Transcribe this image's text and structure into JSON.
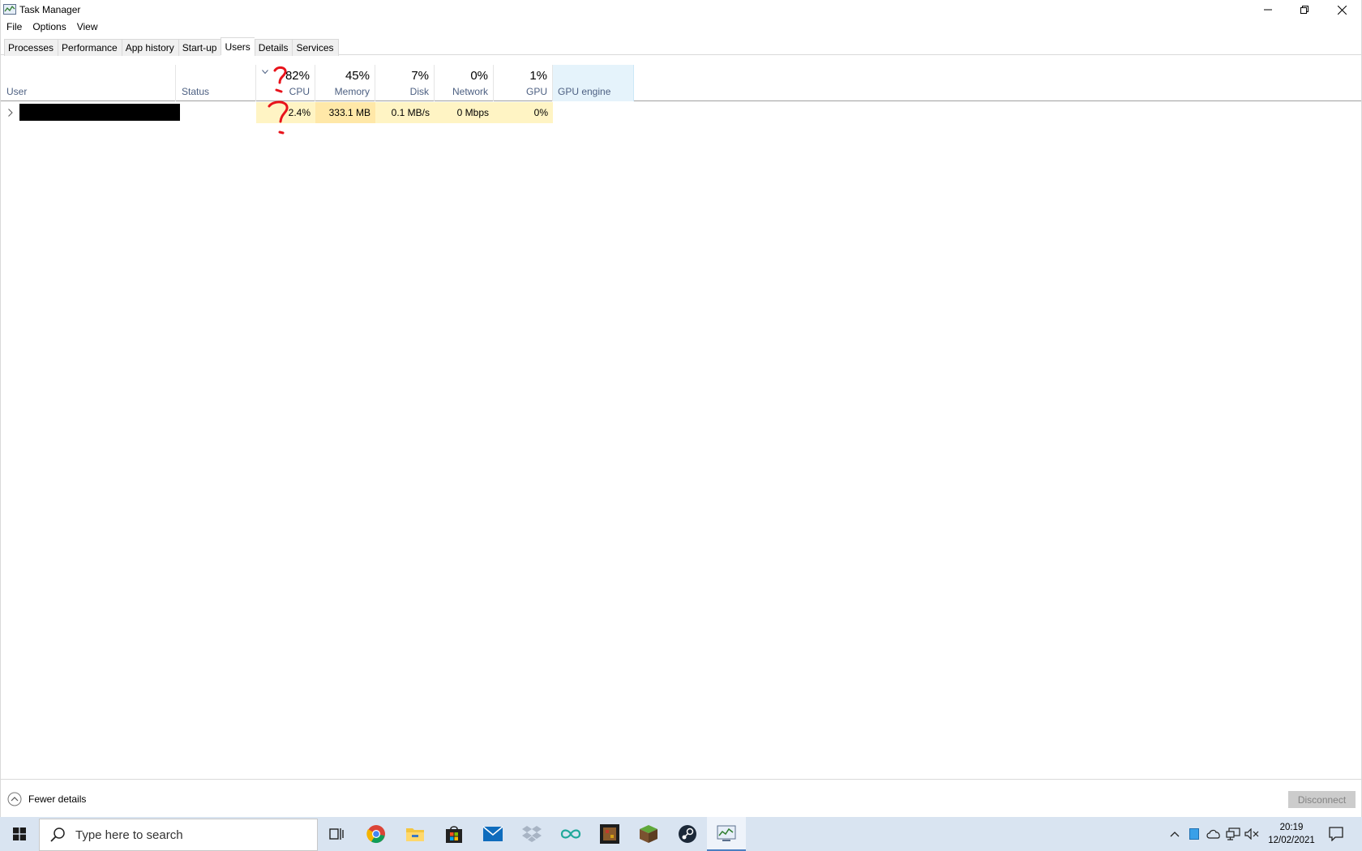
{
  "window": {
    "title": "Task Manager",
    "controls": {
      "minimize": "minimize-icon",
      "restore": "restore-icon",
      "close": "close-icon"
    }
  },
  "menu": [
    "File",
    "Options",
    "View"
  ],
  "tabs": [
    {
      "label": "Processes",
      "active": false
    },
    {
      "label": "Performance",
      "active": false
    },
    {
      "label": "App history",
      "active": false
    },
    {
      "label": "Start-up",
      "active": false
    },
    {
      "label": "Users",
      "active": true
    },
    {
      "label": "Details",
      "active": false
    },
    {
      "label": "Services",
      "active": false
    }
  ],
  "columns": {
    "user": {
      "label": "User"
    },
    "status": {
      "label": "Status"
    },
    "cpu": {
      "percent": "82%",
      "label": "CPU"
    },
    "memory": {
      "percent": "45%",
      "label": "Memory"
    },
    "disk": {
      "percent": "7%",
      "label": "Disk"
    },
    "network": {
      "percent": "0%",
      "label": "Network"
    },
    "gpu": {
      "percent": "1%",
      "label": "GPU"
    },
    "gpu_engine": {
      "label": "GPU engine"
    }
  },
  "rows": [
    {
      "cpu": "2.4%",
      "memory": "333.1 MB",
      "disk": "0.1 MB/s",
      "network": "0 Mbps",
      "gpu": "0%"
    }
  ],
  "footer": {
    "fewer_details": "Fewer details",
    "disconnect": "Disconnect"
  },
  "taskbar": {
    "search_placeholder": "Type here to search",
    "pinned": [
      "task-view-icon",
      "chrome-icon",
      "file-explorer-icon",
      "store-icon",
      "mail-icon",
      "dropbox-icon",
      "infinity-app-icon",
      "game-app-icon",
      "minecraft-icon",
      "steam-icon",
      "task-manager-icon"
    ],
    "clock_time": "20:19",
    "clock_date": "12/02/2021"
  },
  "colors": {
    "accent": "#4a7fc1",
    "heat_light": "#fff4c4",
    "heat_medium": "#ffe8a8",
    "annotation": "#e8131b"
  }
}
